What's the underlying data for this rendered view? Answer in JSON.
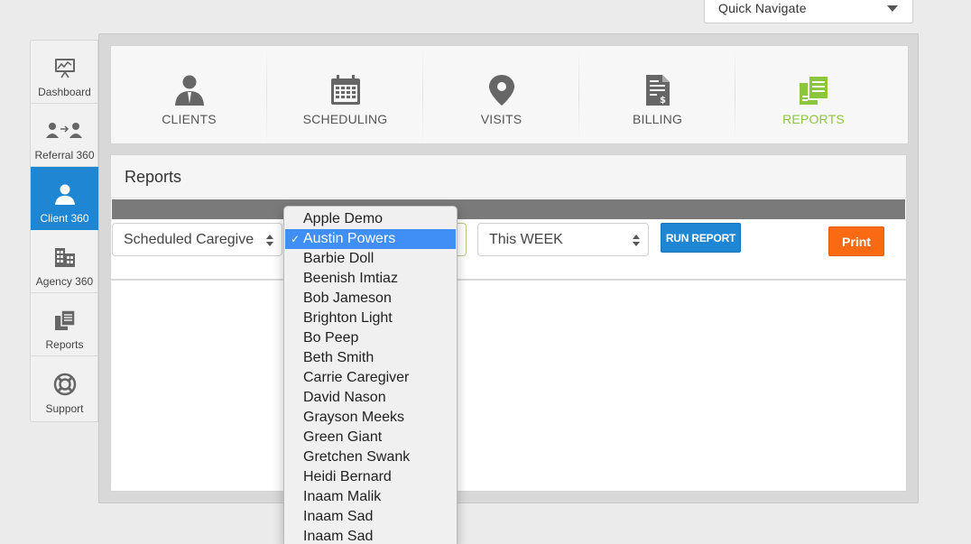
{
  "quick_navigate": {
    "label": "Quick Navigate"
  },
  "sidebar": {
    "items": [
      {
        "label": "Dashboard",
        "icon": "dashboard-icon"
      },
      {
        "label": "Referral 360",
        "icon": "referral-icon"
      },
      {
        "label": "Client 360",
        "icon": "client-icon",
        "active": true
      },
      {
        "label": "Agency 360",
        "icon": "agency-icon"
      },
      {
        "label": "Reports",
        "icon": "reports-icon"
      },
      {
        "label": "Support",
        "icon": "support-icon"
      }
    ]
  },
  "topnav": {
    "items": [
      {
        "label": "CLIENTS",
        "icon": "person-icon"
      },
      {
        "label": "SCHEDULING",
        "icon": "calendar-icon"
      },
      {
        "label": "VISITS",
        "icon": "map-pin-icon"
      },
      {
        "label": "BILLING",
        "icon": "invoice-icon"
      },
      {
        "label": "REPORTS",
        "icon": "reports-icon",
        "active": true
      }
    ],
    "active_color": "#8cc63f"
  },
  "panel": {
    "title": "Reports",
    "report_select": "Scheduled Caregive",
    "period_select": "This WEEK",
    "run_label": "RUN REPORT",
    "print_label": "Print"
  },
  "client_dropdown": {
    "selected": "Austin Powers",
    "options": [
      "Apple Demo",
      "Austin Powers",
      "Barbie Doll",
      "Beenish Imtiaz",
      "Bob Jameson",
      "Brighton Light",
      "Bo Peep",
      "Beth Smith",
      "Carrie Caregiver",
      "David Nason",
      "Grayson Meeks",
      "Green Giant",
      "Gretchen Swank",
      "Heidi Bernard",
      "Inaam Malik",
      "Inaam Sad",
      "Inaam Sad"
    ]
  },
  "colors": {
    "primary": "#1f86d3",
    "print": "#f96a12",
    "selection": "#3f8ff6"
  }
}
